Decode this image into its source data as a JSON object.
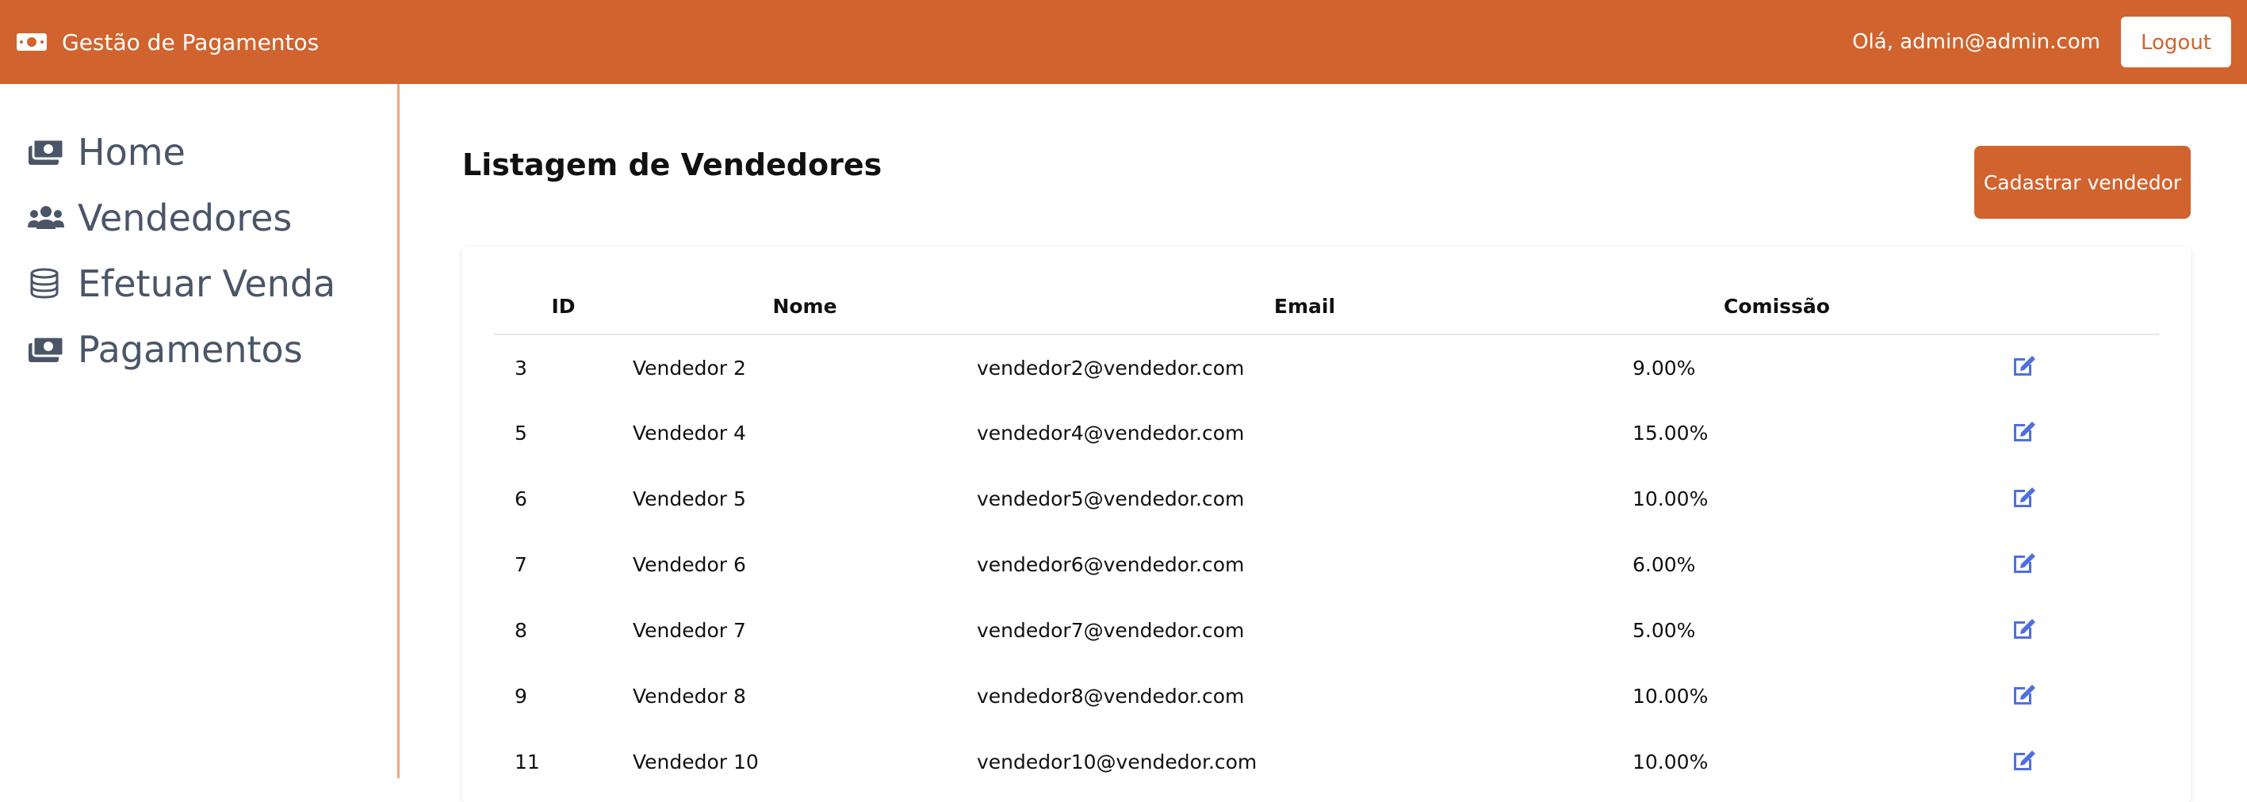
{
  "navbar": {
    "brand": "Gestão de Pagamentos",
    "brand_icon": "money-bill-icon",
    "greeting": "Olá, admin@admin.com",
    "logout_label": "Logout",
    "color": "#d0632e"
  },
  "sidebar": {
    "items": [
      {
        "label": "Home",
        "icon": "money-bill-icon"
      },
      {
        "label": "Vendedores",
        "icon": "users-icon"
      },
      {
        "label": "Efetuar Venda",
        "icon": "coins-icon"
      },
      {
        "label": "Pagamentos",
        "icon": "money-bill-icon"
      }
    ]
  },
  "main": {
    "title": "Listagem de Vendedores",
    "add_button": "Cadastrar vendedor",
    "table": {
      "headers": [
        "ID",
        "Nome",
        "Email",
        "Comissão",
        ""
      ],
      "rows": [
        {
          "id": "3",
          "nome": "Vendedor 2",
          "email": "vendedor2@vendedor.com",
          "comissao": "9.00%"
        },
        {
          "id": "5",
          "nome": "Vendedor 4",
          "email": "vendedor4@vendedor.com",
          "comissao": "15.00%"
        },
        {
          "id": "6",
          "nome": "Vendedor 5",
          "email": "vendedor5@vendedor.com",
          "comissao": "10.00%"
        },
        {
          "id": "7",
          "nome": "Vendedor 6",
          "email": "vendedor6@vendedor.com",
          "comissao": "6.00%"
        },
        {
          "id": "8",
          "nome": "Vendedor 7",
          "email": "vendedor7@vendedor.com",
          "comissao": "5.00%"
        },
        {
          "id": "9",
          "nome": "Vendedor 8",
          "email": "vendedor8@vendedor.com",
          "comissao": "10.00%"
        },
        {
          "id": "11",
          "nome": "Vendedor 10",
          "email": "vendedor10@vendedor.com",
          "comissao": "10.00%"
        }
      ],
      "row_action_icon": "edit-icon",
      "edit_icon_color": "#4f6fe0"
    }
  }
}
